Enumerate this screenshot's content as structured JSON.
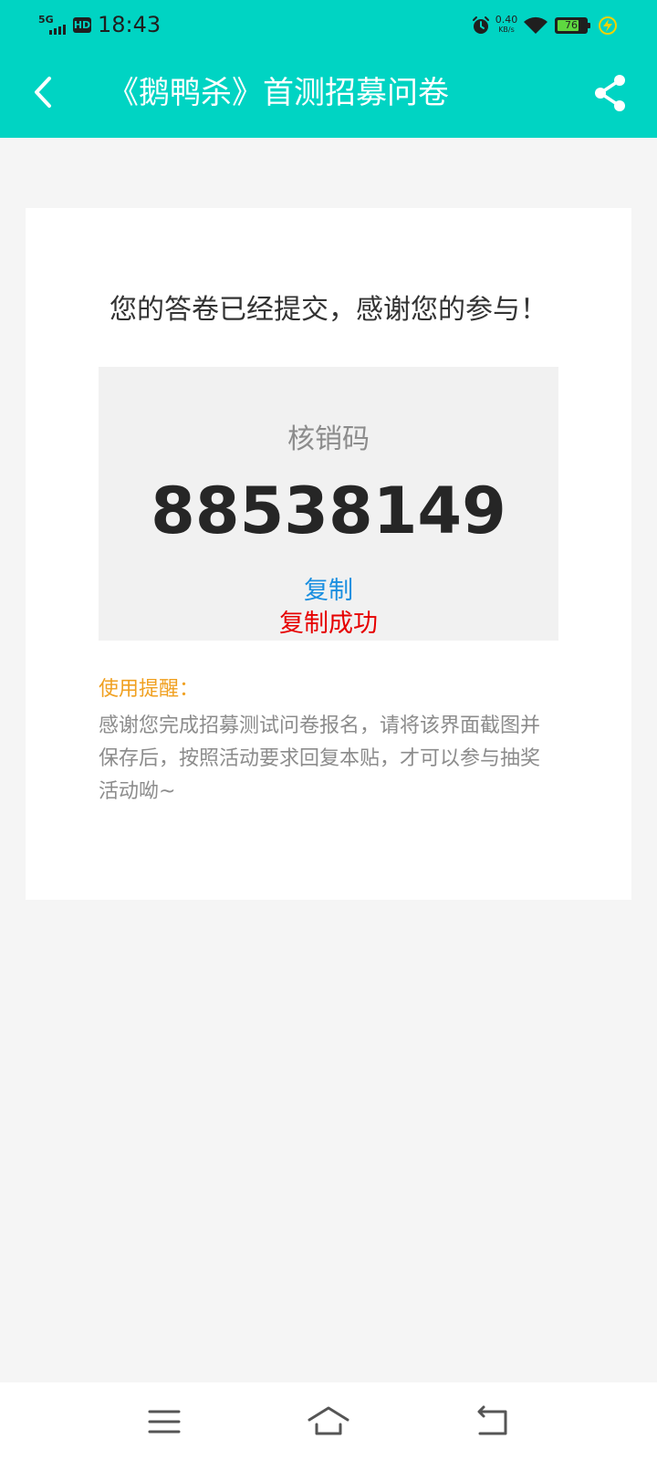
{
  "status_bar": {
    "network": "5G",
    "hd_badge": "HD",
    "time": "18:43",
    "net_speed": "0.40",
    "net_speed_unit": "KB/s",
    "battery_level": "76",
    "battery_fraction": 0.76,
    "icons": [
      "signal-icon",
      "alarm-icon",
      "wifi-icon",
      "battery-icon",
      "charging-icon"
    ]
  },
  "title_bar": {
    "title": "《鹅鸭杀》首测招募问卷",
    "back_icon": "chevron-left-icon",
    "share_icon": "share-icon"
  },
  "card": {
    "thanks_message": "您的答卷已经提交，感谢您的参与！",
    "code_label": "核销码",
    "code_value": "88538149",
    "copy_label": "复制",
    "copy_success": "复制成功",
    "reminder_title": "使用提醒：",
    "reminder_text": "感谢您完成招募测试问卷报名，请将该界面截图并保存后，按照活动要求回复本贴，才可以参与抽奖活动呦~"
  },
  "nav_bar": {
    "icons": [
      "menu-icon",
      "home-icon",
      "back-icon"
    ]
  },
  "colors": {
    "accent": "#00d4c3",
    "link": "#1a8fe0",
    "success": "#e60000",
    "warning": "#f0a020",
    "background": "#f5f5f5"
  }
}
